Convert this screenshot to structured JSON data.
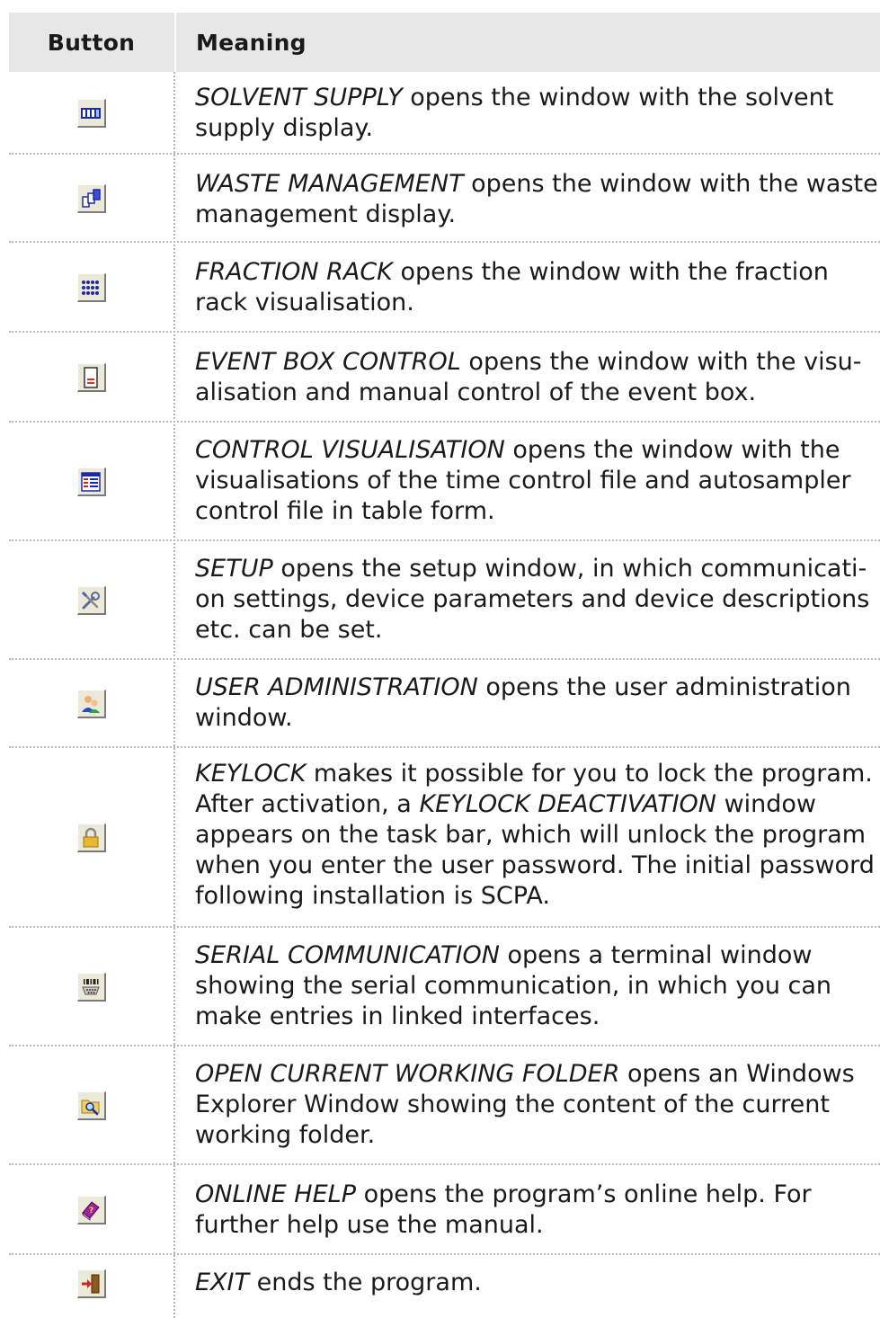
{
  "header": {
    "col_button": "Button",
    "col_meaning": "Meaning"
  },
  "rows": [
    {
      "icon": "solvent-supply-icon",
      "term": "SOLVENT SUPPLY",
      "desc": " opens the window with the solvent supply display."
    },
    {
      "icon": "waste-management-icon",
      "term": "WASTE MANAGEMENT",
      "desc": " opens the window with the waste management display."
    },
    {
      "icon": "fraction-rack-icon",
      "term": "FRACTION RACK",
      "desc": " opens the window with the fraction rack visualisation."
    },
    {
      "icon": "event-box-control-icon",
      "term": "EVENT BOX CONTROL",
      "desc": " opens the window with the visu-alisation and manual control of the event box."
    },
    {
      "icon": "control-visualisation-icon",
      "term": "CONTROL VISUALISATION",
      "desc": " opens the window with the visualisations of the time control file and autosampler control file in table form."
    },
    {
      "icon": "setup-tools-icon",
      "term": "SETUP",
      "desc": " opens the setup window, in which communicati-on settings, device parameters and device descriptions etc. can be set."
    },
    {
      "icon": "user-administration-icon",
      "term": "USER ADMINISTRATION",
      "desc": " opens the user administration window."
    },
    {
      "icon": "keylock-icon",
      "term": "KEYLOCK",
      "desc": " makes it possible for you to lock the program. After activation, a ",
      "term2": "KEYLOCK DEACTIVATION",
      "desc2": " window appears on the task bar, which will unlock the program when you enter the user password. The initial password following installation is SCPA."
    },
    {
      "icon": "serial-communication-icon",
      "term": "SERIAL COMMUNICATION",
      "desc": " opens a terminal window showing the serial communication, in which you can make entries in linked interfaces."
    },
    {
      "icon": "open-folder-icon",
      "term": "OPEN CURRENT WORKING FOLDER",
      "desc": " opens an Windows Explorer Window showing the content of the current working folder."
    },
    {
      "icon": "online-help-icon",
      "term": "ONLINE HELP",
      "desc": " opens the program’s online help. For further help use the manual."
    },
    {
      "icon": "exit-icon",
      "term": "EXIT",
      "desc": " ends the program."
    }
  ]
}
